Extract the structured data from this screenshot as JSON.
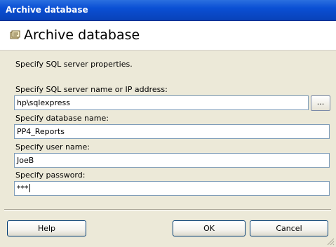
{
  "window": {
    "title": "Archive database"
  },
  "header": {
    "title": "Archive database",
    "icon": "database-icon"
  },
  "instruction": "Specify SQL server properties.",
  "fields": {
    "server": {
      "label": "Specify SQL server name or IP address:",
      "value": "hp\\sqlexpress",
      "browse_label": "..."
    },
    "database": {
      "label": "Specify database name:",
      "value": "PP4_Reports"
    },
    "user": {
      "label": "Specify user name:",
      "value": "JoeB"
    },
    "password": {
      "label": "Specify password:",
      "value": "***"
    }
  },
  "buttons": {
    "help": "Help",
    "ok": "OK",
    "cancel": "Cancel"
  },
  "colors": {
    "title_bar": "#0a4fd4",
    "dialog_bg": "#ece9d8",
    "field_border": "#7f9db9"
  }
}
